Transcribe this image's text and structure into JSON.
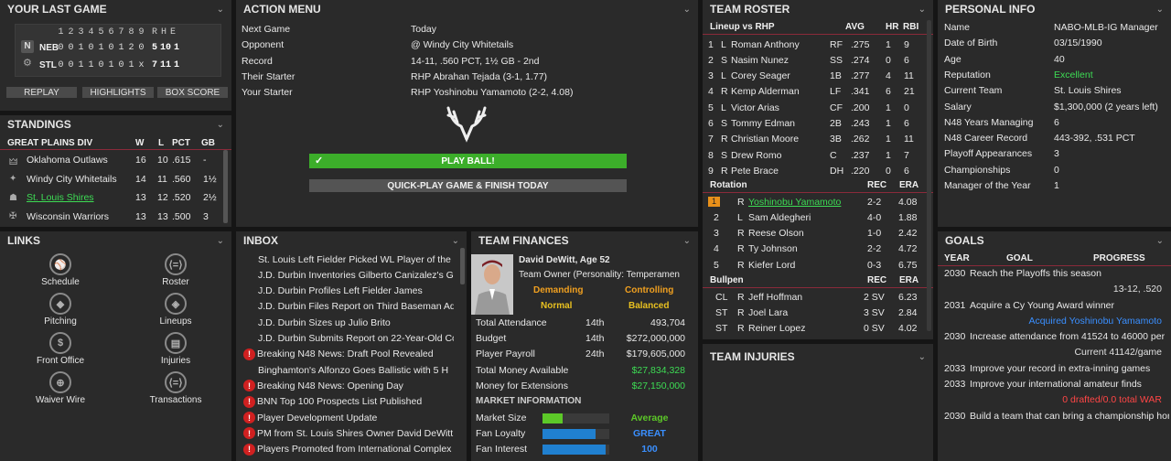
{
  "last_game": {
    "title": "YOUR LAST GAME",
    "innings": [
      "1",
      "2",
      "3",
      "4",
      "5",
      "6",
      "7",
      "8",
      "9"
    ],
    "rhe": [
      "R",
      "H",
      "E"
    ],
    "teams": [
      {
        "abbr": "NEB",
        "line": [
          "0",
          "0",
          "1",
          "0",
          "1",
          "0",
          "1",
          "2",
          "0"
        ],
        "r": "5",
        "h": "10",
        "e": "1"
      },
      {
        "abbr": "STL",
        "line": [
          "0",
          "0",
          "1",
          "1",
          "0",
          "1",
          "0",
          "1",
          "x"
        ],
        "r": "7",
        "h": "11",
        "e": "1"
      }
    ],
    "buttons": [
      "REPLAY",
      "HIGHLIGHTS",
      "BOX SCORE"
    ]
  },
  "standings": {
    "title": "STANDINGS",
    "division": "GREAT PLAINS DIV",
    "cols": [
      "W",
      "L",
      "PCT",
      "GB"
    ],
    "rows": [
      {
        "team": "Oklahoma Outlaws",
        "w": "16",
        "l": "10",
        "pct": ".615",
        "gb": "-"
      },
      {
        "team": "Windy City Whitetails",
        "w": "14",
        "l": "11",
        "pct": ".560",
        "gb": "1½"
      },
      {
        "team": "St. Louis Shires",
        "w": "13",
        "l": "12",
        "pct": ".520",
        "gb": "2½"
      },
      {
        "team": "Wisconsin Warriors",
        "w": "13",
        "l": "13",
        "pct": ".500",
        "gb": "3"
      }
    ]
  },
  "links": {
    "title": "LINKS",
    "items": [
      "Schedule",
      "Roster",
      "Pitching",
      "Lineups",
      "Front Office",
      "Injuries",
      "Waiver Wire",
      "Transactions"
    ]
  },
  "action_menu": {
    "title": "ACTION MENU",
    "rows": [
      {
        "label": "Next Game",
        "value": "Today"
      },
      {
        "label": "Opponent",
        "value": "@ Windy City Whitetails"
      },
      {
        "label": "Record",
        "value": "14-11, .560 PCT, 1½ GB - 2nd"
      },
      {
        "label": "Their Starter",
        "value": "RHP Abrahan Tejada (3-1, 1.77)"
      },
      {
        "label": "Your Starter",
        "value": "RHP Yoshinobu Yamamoto (2-2, 4.08)"
      }
    ],
    "play_ball": "PLAY BALL!",
    "quick_play": "QUICK-PLAY GAME & FINISH TODAY"
  },
  "inbox": {
    "title": "INBOX",
    "items": [
      {
        "text": "St. Louis Left Fielder Picked WL Player of the",
        "alert": false
      },
      {
        "text": "J.D. Durbin Inventories Gilberto Canizalez's Ga",
        "alert": false
      },
      {
        "text": "J.D. Durbin Profiles Left Fielder James",
        "alert": false
      },
      {
        "text": "J.D. Durbin Files Report on Third Baseman Ad",
        "alert": false
      },
      {
        "text": "J.D. Durbin Sizes up Julio Brito",
        "alert": false
      },
      {
        "text": "J.D. Durbin Submits Report on 22-Year-Old Co",
        "alert": false
      },
      {
        "text": "Breaking N48 News: Draft Pool Revealed",
        "alert": true
      },
      {
        "text": "Binghamton's Alfonzo Goes Ballistic with 5 H",
        "alert": false
      },
      {
        "text": "Breaking N48 News: Opening Day",
        "alert": true
      },
      {
        "text": "BNN Top 100 Prospects List Published",
        "alert": true
      },
      {
        "text": "Player Development Update",
        "alert": true
      },
      {
        "text": "PM from St. Louis Shires Owner David DeWitt",
        "alert": true
      },
      {
        "text": "Players Promoted from International Complex",
        "alert": true
      }
    ]
  },
  "finances": {
    "title": "TEAM FINANCES",
    "owner_name": "David DeWitt, Age 52",
    "owner_role": "Team Owner (Personality: Temperamen",
    "traits": [
      {
        "label": "Demanding",
        "value": "Normal"
      },
      {
        "label": "Controlling",
        "value": "Balanced"
      }
    ],
    "rows": [
      {
        "label": "Total Attendance",
        "rank": "14th",
        "value": "493,704"
      },
      {
        "label": "Budget",
        "rank": "14th",
        "value": "$272,000,000"
      },
      {
        "label": "Player Payroll",
        "rank": "24th",
        "value": "$179,605,000"
      },
      {
        "label": "Total Money Available",
        "rank": "",
        "value": "$27,834,328"
      },
      {
        "label": "Money for Extensions",
        "rank": "",
        "value": "$27,150,000"
      }
    ],
    "market_title": "MARKET INFORMATION",
    "market": [
      {
        "label": "Market Size",
        "value": "Average",
        "fill": 0.3,
        "color": "#5cc828"
      },
      {
        "label": "Fan Loyalty",
        "value": "GREAT",
        "fill": 0.8,
        "color": "#2080d0"
      },
      {
        "label": "Fan Interest",
        "value": "100",
        "fill": 0.95,
        "color": "#2080d0"
      }
    ]
  },
  "roster": {
    "title": "TEAM ROSTER",
    "lineup_hdr": [
      "Lineup vs RHP",
      "AVG",
      "HR",
      "RBI"
    ],
    "lineup": [
      {
        "n": "1",
        "b": "L",
        "name": "Roman Anthony",
        "pos": "RF",
        "avg": ".275",
        "hr": "1",
        "rbi": "9"
      },
      {
        "n": "2",
        "b": "S",
        "name": "Nasim Nunez",
        "pos": "SS",
        "avg": ".274",
        "hr": "0",
        "rbi": "6"
      },
      {
        "n": "3",
        "b": "L",
        "name": "Corey Seager",
        "pos": "1B",
        "avg": ".277",
        "hr": "4",
        "rbi": "11"
      },
      {
        "n": "4",
        "b": "R",
        "name": "Kemp Alderman",
        "pos": "LF",
        "avg": ".341",
        "hr": "6",
        "rbi": "21"
      },
      {
        "n": "5",
        "b": "L",
        "name": "Victor Arias",
        "pos": "CF",
        "avg": ".200",
        "hr": "1",
        "rbi": "0"
      },
      {
        "n": "6",
        "b": "S",
        "name": "Tommy Edman",
        "pos": "2B",
        "avg": ".243",
        "hr": "1",
        "rbi": "6"
      },
      {
        "n": "7",
        "b": "R",
        "name": "Christian Moore",
        "pos": "3B",
        "avg": ".262",
        "hr": "1",
        "rbi": "11"
      },
      {
        "n": "8",
        "b": "S",
        "name": "Drew Romo",
        "pos": "C",
        "avg": ".237",
        "hr": "1",
        "rbi": "7"
      },
      {
        "n": "9",
        "b": "R",
        "name": "Pete Brace",
        "pos": "DH",
        "avg": ".220",
        "hr": "0",
        "rbi": "6"
      }
    ],
    "rotation_hdr": [
      "Rotation",
      "REC",
      "ERA"
    ],
    "rotation": [
      {
        "n": "1",
        "t": "R",
        "name": "Yoshinobu Yamamoto",
        "rec": "2-2",
        "era": "4.08"
      },
      {
        "n": "2",
        "t": "L",
        "name": "Sam Aldegheri",
        "rec": "4-0",
        "era": "1.88"
      },
      {
        "n": "3",
        "t": "R",
        "name": "Reese Olson",
        "rec": "1-0",
        "era": "2.42"
      },
      {
        "n": "4",
        "t": "R",
        "name": "Ty Johnson",
        "rec": "2-2",
        "era": "4.72"
      },
      {
        "n": "5",
        "t": "R",
        "name": "Kiefer Lord",
        "rec": "0-3",
        "era": "6.75"
      }
    ],
    "bullpen_hdr": [
      "Bullpen",
      "REC",
      "ERA"
    ],
    "bullpen": [
      {
        "role": "CL",
        "t": "R",
        "name": "Jeff Hoffman",
        "rec": "2 SV",
        "era": "6.23"
      },
      {
        "role": "ST",
        "t": "R",
        "name": "Joel Lara",
        "rec": "3 SV",
        "era": "2.84"
      },
      {
        "role": "ST",
        "t": "R",
        "name": "Reiner Lopez",
        "rec": "0 SV",
        "era": "4.02"
      }
    ]
  },
  "injuries": {
    "title": "TEAM INJURIES"
  },
  "personal": {
    "title": "PERSONAL INFO",
    "rows": [
      {
        "label": "Name",
        "value": "NABO-MLB-IG Manager"
      },
      {
        "label": "Date of Birth",
        "value": "03/15/1990"
      },
      {
        "label": "Age",
        "value": "40"
      },
      {
        "label": "Reputation",
        "value": "Excellent"
      },
      {
        "label": "Current Team",
        "value": "St. Louis Shires"
      },
      {
        "label": "Salary",
        "value": "$1,300,000 (2 years left)"
      },
      {
        "label": "N48 Years Managing",
        "value": "6"
      },
      {
        "label": "N48 Career Record",
        "value": "443-392, .531 PCT"
      },
      {
        "label": "Playoff Appearances",
        "value": "3"
      },
      {
        "label": "Championships",
        "value": "0"
      },
      {
        "label": "Manager of the Year",
        "value": "1"
      }
    ]
  },
  "goals": {
    "title": "GOALS",
    "cols": [
      "YEAR",
      "GOAL",
      "PROGRESS"
    ],
    "items": [
      {
        "year": "2030",
        "goal": "Reach the Playoffs this season",
        "progress": "13-12, .520",
        "pcolor": "#e0e0e0"
      },
      {
        "year": "2031",
        "goal": "Acquire a Cy Young Award winner",
        "progress": "Acquired Yoshinobu Yamamoto",
        "pcolor": "#3a8fff"
      },
      {
        "year": "2030",
        "goal": "Increase attendance from 41524 to 46000 per",
        "progress": "Current 41142/game",
        "pcolor": "#e0e0e0"
      },
      {
        "year": "2033",
        "goal": "Improve your record in extra-inning games",
        "progress": "",
        "pcolor": "#e0e0e0"
      },
      {
        "year": "2033",
        "goal": "Improve your international amateur finds",
        "progress": "0 drafted/0.0 total WAR",
        "pcolor": "#ff4646"
      },
      {
        "year": "2030",
        "goal": "Build a team that can bring a championship hor",
        "progress": "",
        "pcolor": "#e0e0e0"
      }
    ]
  }
}
